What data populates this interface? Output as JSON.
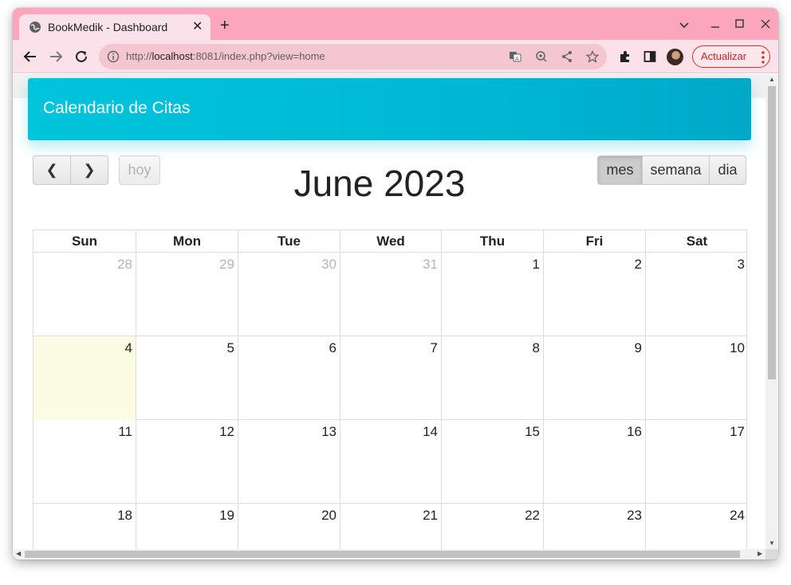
{
  "browser": {
    "tab_title": "BookMedik - Dashboard",
    "url_prefix": "http://",
    "url_host": "localhost",
    "url_rest": ":8081/index.php?view=home",
    "update_label": "Actualizar"
  },
  "page": {
    "header_title": "Calendario de Citas",
    "prev_label": "❮",
    "next_label": "❯",
    "today_label": "hoy",
    "calendar_title": "June 2023",
    "views": [
      "mes",
      "semana",
      "dia"
    ],
    "active_view": "mes"
  },
  "calendar": {
    "weekdays": [
      "Sun",
      "Mon",
      "Tue",
      "Wed",
      "Thu",
      "Fri",
      "Sat"
    ],
    "weeks": [
      [
        "28",
        "29",
        "30",
        "31",
        "1",
        "2",
        "3"
      ],
      [
        "4",
        "5",
        "6",
        "7",
        "8",
        "9",
        "10"
      ],
      [
        "11",
        "12",
        "13",
        "14",
        "15",
        "16",
        "17"
      ],
      [
        "18",
        "19",
        "20",
        "21",
        "22",
        "23",
        "24"
      ]
    ],
    "other_month_days": [
      "28",
      "29",
      "30",
      "31"
    ],
    "highlighted_day": "4"
  },
  "icons": {
    "tab": "globe-icon",
    "toolbar": [
      "back-icon",
      "forward-icon",
      "reload-icon",
      "info-icon",
      "translate-icon",
      "zoom-icon",
      "share-icon",
      "star-icon",
      "extensions-icon",
      "side-panel-icon",
      "profile-avatar",
      "more-icon"
    ]
  },
  "colors": {
    "tabbar": "#fba6bd",
    "toolbar": "#fbe2ea",
    "header_card": "#00bcd4",
    "today_cell": "#fcfbe3",
    "update_button": "#c5221f"
  }
}
